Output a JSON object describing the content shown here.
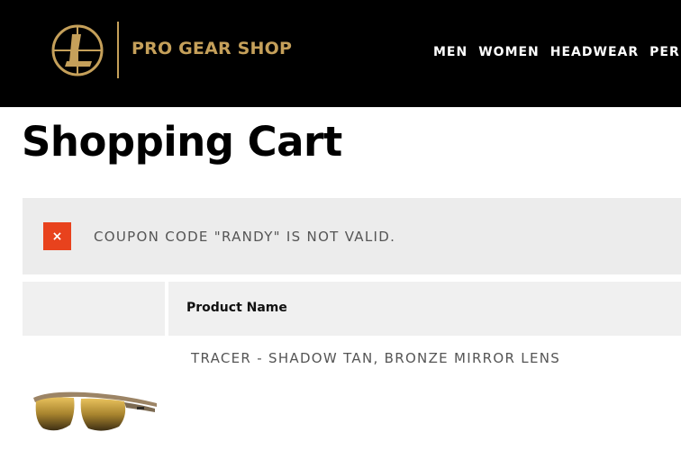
{
  "header": {
    "brand": "PRO GEAR SHOP",
    "nav": [
      "MEN",
      "WOMEN",
      "HEADWEAR",
      "PER"
    ]
  },
  "page": {
    "title": "Shopping Cart"
  },
  "notice": {
    "close_icon": "×",
    "message": "COUPON CODE \"RANDY\" IS NOT VALID."
  },
  "cart": {
    "columns": [
      "Product Name"
    ],
    "items": [
      {
        "name": "TRACER - SHADOW TAN, BRONZE MIRROR LENS"
      }
    ]
  },
  "colors": {
    "header_bg": "#000000",
    "brand_gold": "#c5a05a",
    "error_red": "#e8421d",
    "notice_bg": "#ececec"
  }
}
